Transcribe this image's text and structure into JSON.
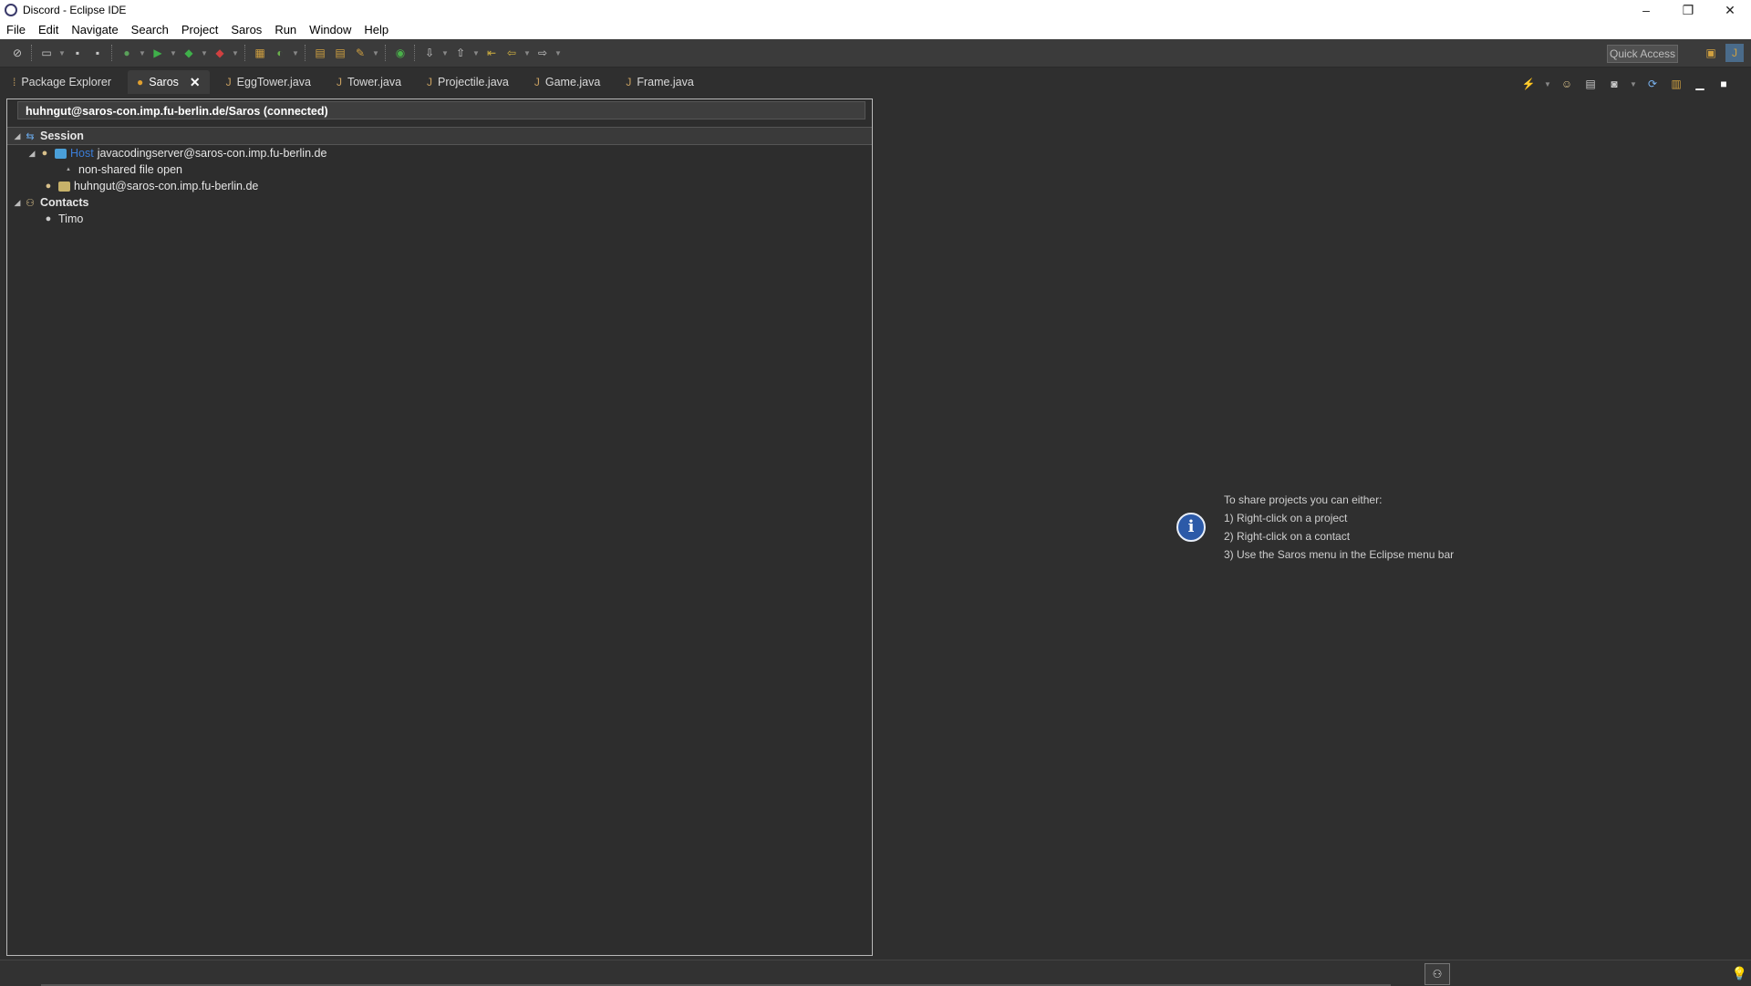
{
  "window": {
    "title": "Discord - Eclipse IDE",
    "controls": [
      "–",
      "❐",
      "✕"
    ]
  },
  "menu": [
    "File",
    "Edit",
    "Navigate",
    "Search",
    "Project",
    "Saros",
    "Run",
    "Window",
    "Help"
  ],
  "toolbar": {
    "quick_access": "Quick Access"
  },
  "tabs": [
    {
      "label": "Package Explorer",
      "icon": "package-explorer-icon"
    },
    {
      "label": "Saros",
      "icon": "saros-icon",
      "active": true
    },
    {
      "label": "EggTower.java",
      "icon": "java-file-icon"
    },
    {
      "label": "Tower.java",
      "icon": "java-file-icon"
    },
    {
      "label": "Projectile.java",
      "icon": "java-file-icon"
    },
    {
      "label": "Game.java",
      "icon": "java-file-icon"
    },
    {
      "label": "Frame.java",
      "icon": "java-file-icon"
    }
  ],
  "saros": {
    "header": "huhngut@saros-con.imp.fu-berlin.de/Saros (connected)",
    "session_label": "Session",
    "host_tag": "Host",
    "host_user": "javacodingserver@saros-con.imp.fu-berlin.de",
    "host_status": "non-shared file open",
    "second_user": "huhngut@saros-con.imp.fu-berlin.de",
    "contacts_label": "Contacts",
    "contact_1": "Timo",
    "host_color": "#4a9fd8",
    "user_color": "#c7b26a"
  },
  "info": {
    "line1": "To share projects you can either:",
    "line2": "1)  Right-click on a project",
    "line3": "2)  Right-click on a contact",
    "line4": "3)  Use the Saros menu in the Eclipse menu bar"
  }
}
